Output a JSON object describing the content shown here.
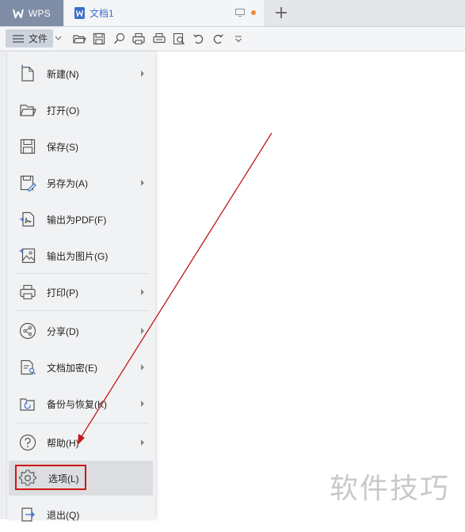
{
  "tabs": {
    "app_label": "WPS",
    "document_title": "文档1"
  },
  "toolbar": {
    "file_label": "文件",
    "icons": [
      "open-folder-icon",
      "save-icon",
      "search-icon",
      "print-icon",
      "print-preview-icon",
      "find-icon",
      "undo-icon",
      "redo-icon",
      "more-icon"
    ]
  },
  "menu": {
    "items": [
      {
        "label": "新建(N)",
        "icon": "new-file-icon",
        "submenu": true
      },
      {
        "label": "打开(O)",
        "icon": "open-folder-icon",
        "submenu": false
      },
      {
        "label": "保存(S)",
        "icon": "save-icon",
        "submenu": false
      },
      {
        "label": "另存为(A)",
        "icon": "save-as-icon",
        "submenu": true
      },
      {
        "label": "输出为PDF(F)",
        "icon": "export-pdf-icon",
        "submenu": false
      },
      {
        "label": "输出为图片(G)",
        "icon": "export-image-icon",
        "submenu": false
      },
      {
        "label": "打印(P)",
        "icon": "print-icon",
        "submenu": true
      },
      {
        "label": "分享(D)",
        "icon": "share-icon",
        "submenu": true
      },
      {
        "label": "文档加密(E)",
        "icon": "encrypt-icon",
        "submenu": true
      },
      {
        "label": "备份与恢复(K)",
        "icon": "backup-icon",
        "submenu": true
      },
      {
        "label": "帮助(H)",
        "icon": "help-icon",
        "submenu": true
      },
      {
        "label": "选项(L)",
        "icon": "gear-icon",
        "submenu": false,
        "active": true
      },
      {
        "label": "退出(Q)",
        "icon": "exit-icon",
        "submenu": false
      }
    ]
  },
  "watermark": "软件技巧",
  "colors": {
    "wps_tab": "#7f8ea6",
    "accent_blue": "#3b70c9",
    "annotation_red": "#d01515",
    "unsaved_dot": "#f08a3c"
  }
}
